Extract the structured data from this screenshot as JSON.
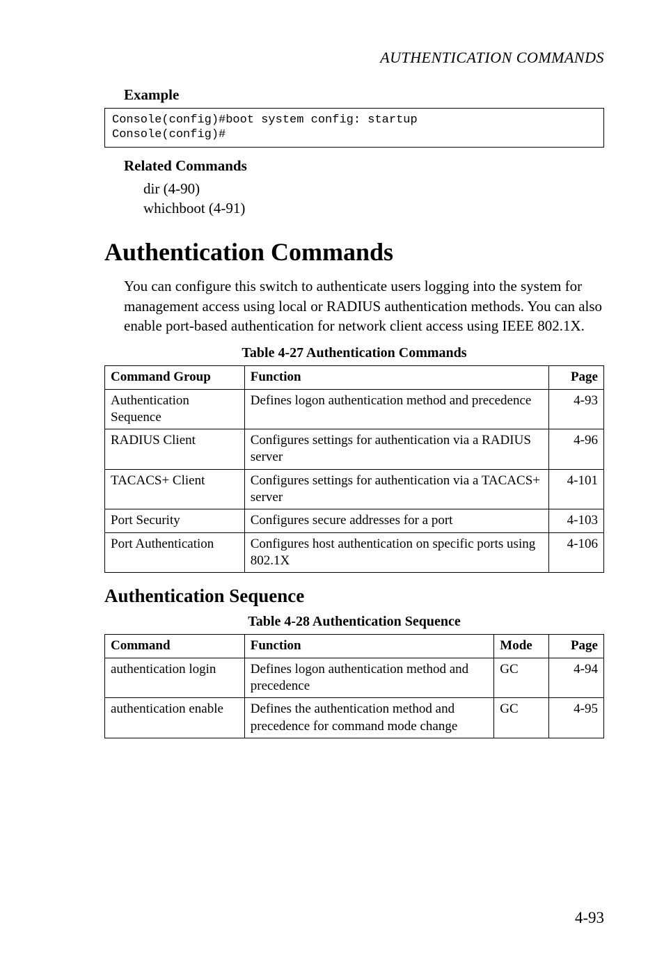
{
  "running_head": "AUTHENTICATION COMMANDS",
  "example": {
    "heading": "Example",
    "code": "Console(config)#boot system config: startup\nConsole(config)#"
  },
  "related": {
    "heading": "Related Commands",
    "items": [
      "dir (4-90)",
      "whichboot (4-91)"
    ]
  },
  "section_title": "Authentication Commands",
  "intro_para": "You can configure this switch to authenticate users logging into the system for management access using local or RADIUS authentication methods. You can also enable port-based authentication for network client access using IEEE 802.1X.",
  "table27": {
    "caption": "Table 4-27  Authentication Commands",
    "headers": {
      "group": "Command Group",
      "func": "Function",
      "page": "Page"
    },
    "rows": [
      {
        "group": "Authentication Sequence",
        "func": "Defines logon authentication method and precedence",
        "page": "4-93"
      },
      {
        "group": "RADIUS Client",
        "func": "Configures settings for authentication via a RADIUS server",
        "page": "4-96"
      },
      {
        "group": "TACACS+ Client",
        "func": "Configures settings for authentication via a TACACS+ server",
        "page": "4-101"
      },
      {
        "group": "Port Security",
        "func": "Configures secure addresses for a port",
        "page": "4-103"
      },
      {
        "group": "Port Authentication",
        "func": "Configures host authentication on specific ports using 802.1X",
        "page": "4-106"
      }
    ]
  },
  "subsection_title": "Authentication Sequence",
  "table28": {
    "caption": "Table 4-28  Authentication Sequence",
    "headers": {
      "cmd": "Command",
      "func": "Function",
      "mode": "Mode",
      "page": "Page"
    },
    "rows": [
      {
        "cmd": "authentication login",
        "func": "Defines logon authentication method and precedence",
        "mode": "GC",
        "page": "4-94"
      },
      {
        "cmd": "authentication enable",
        "func": "Defines the authentication method and precedence for  command mode change",
        "mode": "GC",
        "page": "4-95"
      }
    ]
  },
  "page_number": "4-93"
}
